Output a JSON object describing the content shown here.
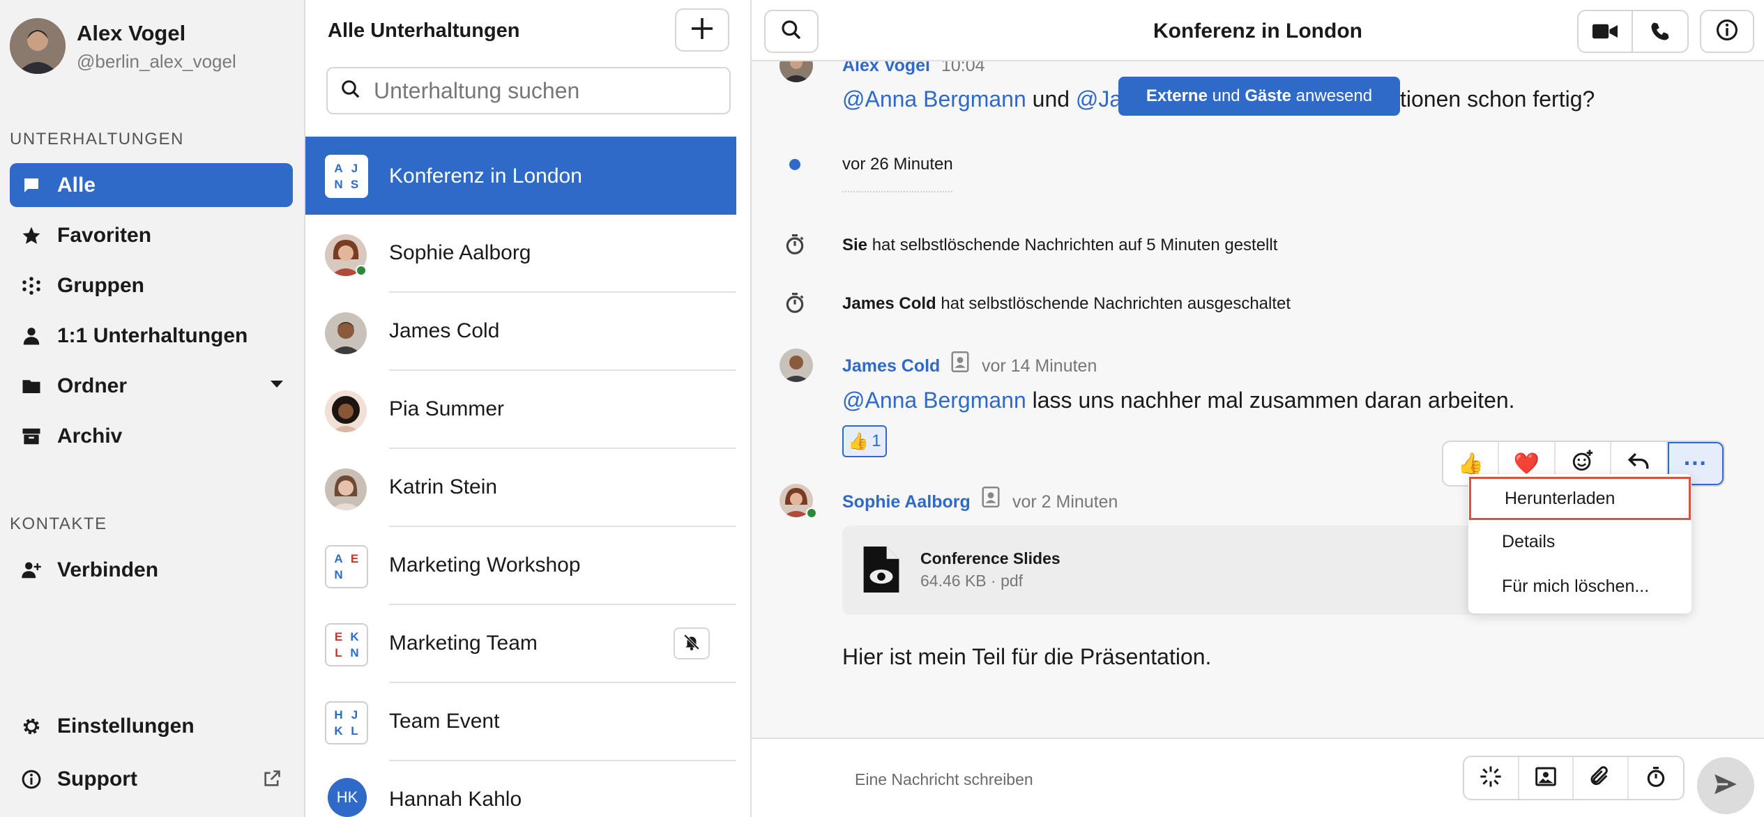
{
  "profile": {
    "name": "Alex Vogel",
    "handle": "@berlin_alex_vogel"
  },
  "sidebar": {
    "section_conversations": "UNTERHALTUNGEN",
    "items": [
      {
        "label": "Alle",
        "icon": "chat-bubble-icon"
      },
      {
        "label": "Favoriten",
        "icon": "star-icon"
      },
      {
        "label": "Gruppen",
        "icon": "groups-dots-icon"
      },
      {
        "label": "1:1 Unterhaltungen",
        "icon": "person-icon"
      },
      {
        "label": "Ordner",
        "icon": "folder-icon"
      },
      {
        "label": "Archiv",
        "icon": "archive-icon"
      }
    ],
    "section_contacts": "KONTAKTE",
    "connect": "Verbinden",
    "settings": "Einstellungen",
    "support": "Support"
  },
  "convlist": {
    "title": "Alle Unterhaltungen",
    "search_placeholder": "Unterhaltung suchen",
    "items": [
      {
        "name": "Konferenz in London",
        "initials": [
          "A",
          "J",
          "N",
          "S"
        ]
      },
      {
        "name": "Sophie Aalborg"
      },
      {
        "name": "James Cold"
      },
      {
        "name": "Pia Summer"
      },
      {
        "name": "Katrin Stein"
      },
      {
        "name": "Marketing Workshop",
        "initials": [
          "A",
          "E",
          "N",
          ""
        ]
      },
      {
        "name": "Marketing Team",
        "initials": [
          "E",
          "K",
          "L",
          "N"
        ]
      },
      {
        "name": "Team Event",
        "initials": [
          "H",
          "J",
          "K",
          "L"
        ]
      },
      {
        "name": "Hannah Kahlo",
        "initials_text": "HK"
      }
    ]
  },
  "chat": {
    "title": "Konferenz in London",
    "guest_badge": {
      "b1": "Externe",
      "t1": " und ",
      "b2": "Gäste",
      "t2": " anwesend"
    },
    "msg1": {
      "sender": "Alex Vogel",
      "time": "10:04",
      "mention1": "@Anna Bergmann",
      "text1": " und ",
      "mention2": "@Ja",
      "text2": "tionen schon fertig?"
    },
    "unread_marker": "vor 26 Minuten",
    "sys1": {
      "who": "Sie",
      "text": " hat selbstlöschende Nachrichten auf 5 Minuten gestellt"
    },
    "sys2": {
      "who": "James Cold",
      "text": " hat selbstlöschende Nachrichten ausgeschaltet"
    },
    "msg2": {
      "sender": "James Cold",
      "time": "vor 14 Minuten",
      "mention": "@Anna Bergmann",
      "text": " lass uns nachher mal zusammen daran arbeiten.",
      "reaction_emoji": "👍",
      "reaction_count": "1"
    },
    "msg3": {
      "sender": "Sophie Aalborg",
      "time": "vor 2 Minuten",
      "file_name": "Conference Slides",
      "file_meta": "64.46 KB · pdf",
      "text": "Hier ist mein Teil für die Präsentation."
    },
    "toolbar": {
      "thumbs": "👍",
      "heart": "❤️",
      "more": "···"
    },
    "menu": [
      "Herunterladen",
      "Details",
      "Für mich löschen..."
    ],
    "composer_placeholder": "Eine Nachricht schreiben"
  },
  "colors": {
    "accent": "#2f6ac9",
    "online": "#2a8a3a",
    "highlight_border": "#d9533e"
  }
}
